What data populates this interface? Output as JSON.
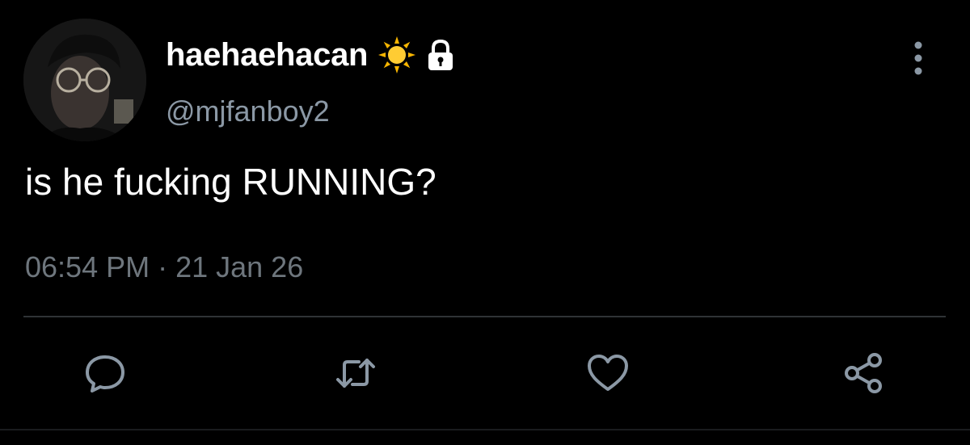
{
  "user": {
    "display_name": "haehaehacan",
    "handle": "@mjfanboy2",
    "badges": [
      "sun-emoji",
      "lock-icon"
    ],
    "avatar": "avatar-photo"
  },
  "tweet": {
    "text": "is he fucking RUNNING?",
    "time": "06:54 PM",
    "separator": "·",
    "date": "21 Jan 26"
  },
  "actions": [
    {
      "name": "reply",
      "icon": "reply-icon"
    },
    {
      "name": "retweet",
      "icon": "retweet-icon"
    },
    {
      "name": "like",
      "icon": "heart-icon"
    },
    {
      "name": "share",
      "icon": "share-icon"
    }
  ],
  "colors": {
    "background": "#000000",
    "primary_text": "#ffffff",
    "secondary_text": "#8b98a5",
    "timestamp_text": "#6e767d",
    "icon": "#8b98a5",
    "divider": "#2f3336"
  }
}
